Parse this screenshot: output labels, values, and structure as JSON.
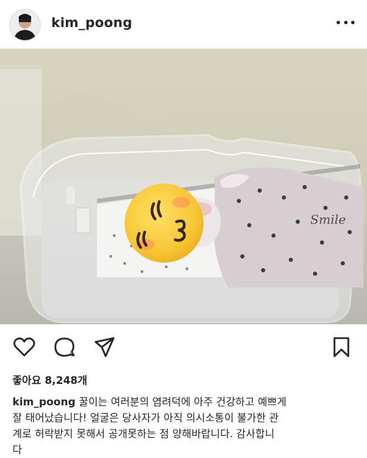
{
  "post": {
    "username": "kim_poong",
    "likes_text": "좋아요 8,248개",
    "caption_user": "kim_poong",
    "caption_text": "꿀이는 여러분의 염려덕에 아주 건강하고 예쁘게\n잘 태어났습니다! 얼굴은 당사자가 아직 의시소통이 불가한 관\n계로 허락받지 못해서 공개못하는 점 양해바랍니다. 감사합니\n다",
    "photo": {
      "blanket_text": "Smile",
      "sticker": "blushing-emoji"
    }
  },
  "icons": {
    "more": "more-options-icon",
    "like": "heart-icon",
    "comment": "comment-icon",
    "share": "paper-plane-icon",
    "save": "bookmark-icon"
  }
}
